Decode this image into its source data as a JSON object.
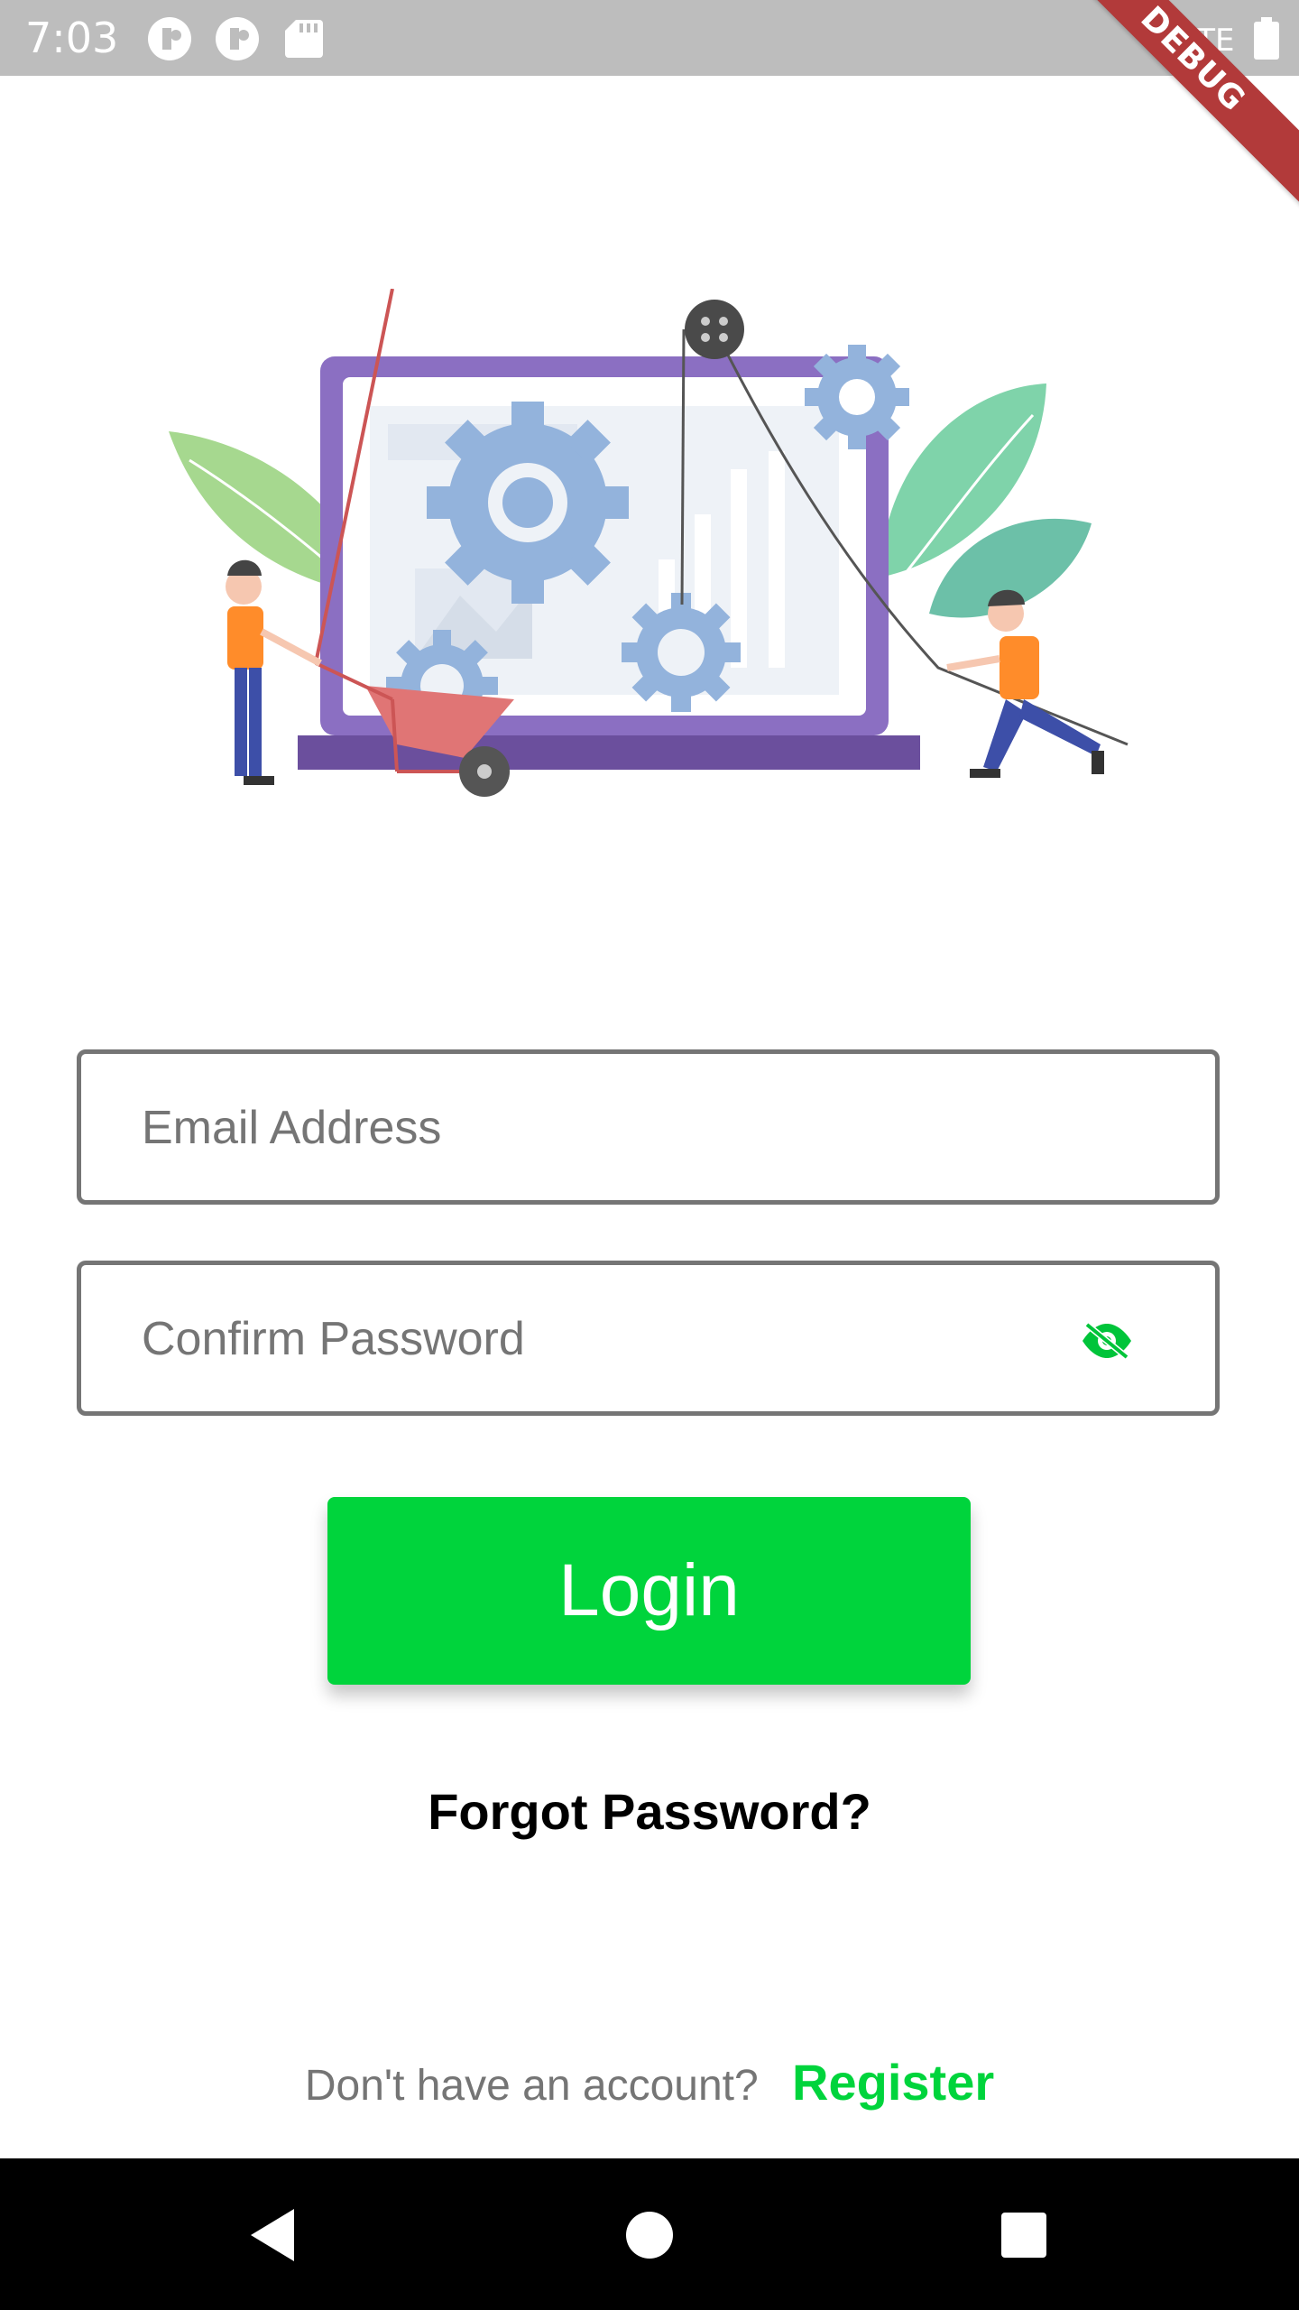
{
  "status_bar": {
    "time": "7:03",
    "left_icons": [
      "notification-icon",
      "notification-icon",
      "sd-card-icon"
    ],
    "network": "LTE",
    "right_icons": [
      "signal-icon",
      "battery-icon"
    ]
  },
  "debug_banner": "DEBUG",
  "illustration": {
    "icon": "gears-laptop-illustration"
  },
  "form": {
    "email_placeholder": "Email Address",
    "password_placeholder": "Confirm Password",
    "visibility_icon": "visibility-off-icon",
    "login_label": "Login",
    "forgot_label": "Forgot Password?"
  },
  "footer": {
    "prompt": "Don't have an account?",
    "register_label": "Register"
  },
  "nav": {
    "back": "back-icon",
    "home": "home-icon",
    "recents": "recents-icon"
  },
  "colors": {
    "accent": "#00d43c",
    "status_bar": "#bdbdbd",
    "field_border": "#757575",
    "debug_banner": "#b23a3a",
    "nav_bar": "#000000"
  }
}
